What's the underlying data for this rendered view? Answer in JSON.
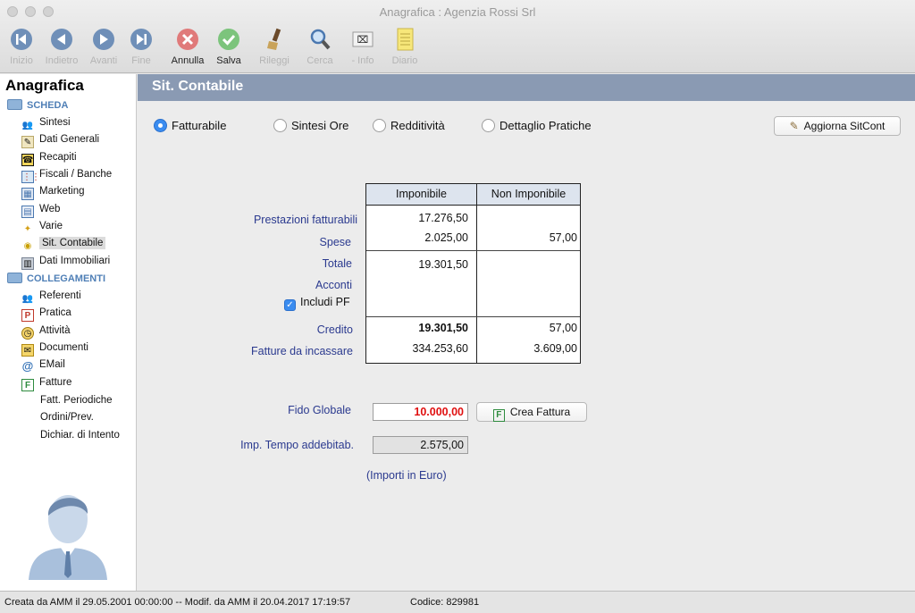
{
  "window": {
    "title": "Anagrafica : Agenzia Rossi Srl"
  },
  "toolbar": {
    "inizio": "Inizio",
    "indietro": "Indietro",
    "avanti": "Avanti",
    "fine": "Fine",
    "annulla": "Annulla",
    "salva": "Salva",
    "rileggi": "Rileggi",
    "cerca": "Cerca",
    "info": "- Info",
    "diario": "Diario"
  },
  "sidebar": {
    "title": "Anagrafica",
    "scheda": "SCHEDA",
    "items": [
      "Sintesi",
      "Dati Generali",
      "Recapiti",
      "Fiscali / Banche",
      "Marketing",
      "Web",
      "Varie",
      "Sit. Contabile",
      "Dati Immobiliari"
    ],
    "collegamenti": "COLLEGAMENTI",
    "links": [
      "Referenti",
      "Pratica",
      "Attività",
      "Documenti",
      "EMail",
      "Fatture"
    ],
    "sublinks": [
      "Fatt. Periodiche",
      "Ordini/Prev.",
      "Dichiar. di Intento"
    ]
  },
  "main": {
    "header": "Sit. Contabile",
    "radios": [
      "Fatturabile",
      "Sintesi Ore",
      "Redditività",
      "Dettaglio Pratiche"
    ],
    "selected_radio": "Fatturabile",
    "aggiorna": "Aggiorna SitCont",
    "table": {
      "col1": "Imponibile",
      "col2": "Non Imponibile",
      "rows": {
        "prestazioni": {
          "label": "Prestazioni fatturabili",
          "imp": "17.276,50",
          "nonimp": ""
        },
        "spese": {
          "label": "Spese",
          "imp": "2.025,00",
          "nonimp": "57,00"
        },
        "totale": {
          "label": "Totale",
          "imp": "19.301,50",
          "nonimp": ""
        },
        "acconti": {
          "label": "Acconti",
          "imp": "",
          "nonimp": ""
        },
        "credito": {
          "label": "Credito",
          "imp": "19.301,50",
          "nonimp": "57,00"
        },
        "fatture": {
          "label": "Fatture da incassare",
          "imp": "334.253,60",
          "nonimp": "3.609,00"
        }
      }
    },
    "includi_pf": "Includi PF",
    "fido_label": "Fido Globale",
    "fido_value": "10.000,00",
    "crea_fattura": "Crea Fattura",
    "imp_tempo_label": "Imp. Tempo addebitab.",
    "imp_tempo_value": "2.575,00",
    "note": "(Importi in Euro)"
  },
  "status": {
    "created": "Creata da AMM il 29.05.2001 00:00:00 -- Modif. da AMM il 20.04.2017 17:19:57",
    "codice": "Codice: 829981"
  },
  "colors": {
    "header": "#8a9ab3",
    "label_blue": "#2b3a8f",
    "fido_red": "#e01010",
    "accent": "#3a8cf0"
  }
}
